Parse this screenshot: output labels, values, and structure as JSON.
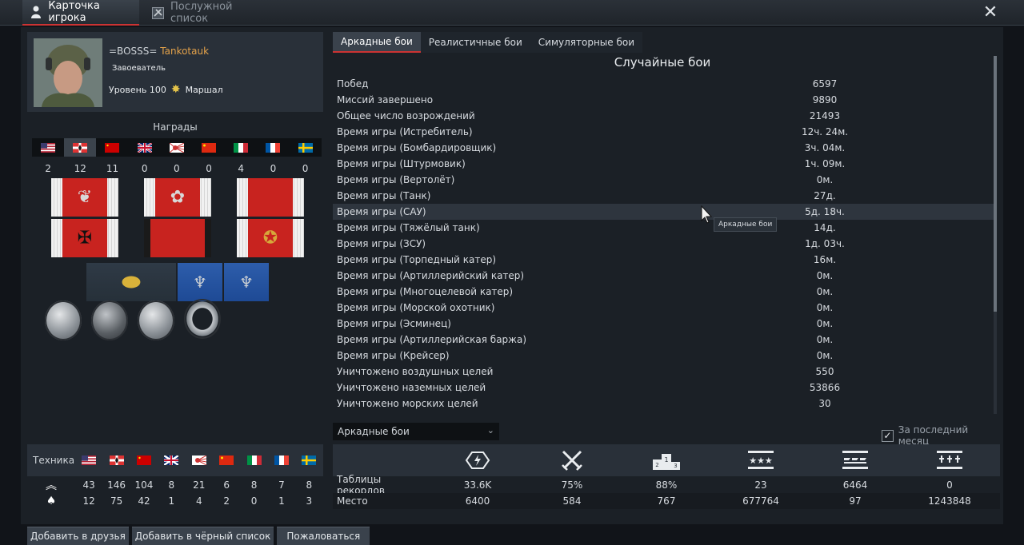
{
  "window": {
    "tabs": [
      {
        "label": "Карточка игрока",
        "active": true,
        "icon": "player-card-icon"
      },
      {
        "label": "Послужной список",
        "active": false,
        "icon": "service-record-icon"
      }
    ],
    "close_icon": "close-icon"
  },
  "profile": {
    "clan_tag": "=BOSSS=",
    "nickname": "Tankotauk",
    "title": "Завоеватель",
    "level_label": "Уровень 100",
    "rank": "Маршал"
  },
  "awards": {
    "title": "Награды",
    "nations": [
      "usa",
      "germany",
      "ussr",
      "britain",
      "japan",
      "china",
      "italy",
      "france",
      "sweden"
    ],
    "selected_nation_index": 1,
    "counts": [
      "2",
      "12",
      "11",
      "0",
      "0",
      "0",
      "4",
      "0",
      "0"
    ]
  },
  "tech": {
    "label": "Техника",
    "nations": [
      "usa",
      "germany",
      "ussr",
      "britain",
      "japan",
      "china",
      "italy",
      "france",
      "sweden"
    ],
    "row_top": [
      "43",
      "146",
      "104",
      "8",
      "21",
      "6",
      "8",
      "7",
      "8"
    ],
    "row_bottom": [
      "12",
      "75",
      "42",
      "1",
      "4",
      "2",
      "0",
      "1",
      "3"
    ]
  },
  "stats_tabs": [
    {
      "label": "Аркадные бои",
      "active": true
    },
    {
      "label": "Реалистичные бои",
      "active": false
    },
    {
      "label": "Симуляторные бои",
      "active": false
    }
  ],
  "stats": {
    "title": "Случайные бои",
    "rows": [
      {
        "name": "Побед",
        "value": "6597"
      },
      {
        "name": "Миссий завершено",
        "value": "9890"
      },
      {
        "name": "Общее число возрождений",
        "value": "21493"
      },
      {
        "name": "Время игры (Истребитель)",
        "value": "12ч. 24м."
      },
      {
        "name": "Время игры (Бомбардировщик)",
        "value": "3ч. 04м."
      },
      {
        "name": "Время игры (Штурмовик)",
        "value": "1ч. 09м."
      },
      {
        "name": "Время игры (Вертолёт)",
        "value": "0м."
      },
      {
        "name": "Время игры (Танк)",
        "value": "27д."
      },
      {
        "name": "Время игры (САУ)",
        "value": "5д. 18ч."
      },
      {
        "name": "Время игры (Тяжёлый танк)",
        "value": "14д."
      },
      {
        "name": "Время игры (ЗСУ)",
        "value": "1д. 03ч."
      },
      {
        "name": "Время игры (Торпедный катер)",
        "value": "16м."
      },
      {
        "name": "Время игры (Артиллерийский катер)",
        "value": "0м."
      },
      {
        "name": "Время игры (Многоцелевой катер)",
        "value": "0м."
      },
      {
        "name": "Время игры (Морской охотник)",
        "value": "0м."
      },
      {
        "name": "Время игры (Эсминец)",
        "value": "0м."
      },
      {
        "name": "Время игры (Артиллерийская баржа)",
        "value": "0м."
      },
      {
        "name": "Время игры (Крейсер)",
        "value": "0м."
      },
      {
        "name": "Уничтожено воздушных целей",
        "value": "550"
      },
      {
        "name": "Уничтожено наземных целей",
        "value": "53866"
      },
      {
        "name": "Уничтожено морских целей",
        "value": "30"
      }
    ],
    "highlighted_row": 8,
    "tooltip": "Аркадные бои"
  },
  "filter": {
    "dropdown_value": "Аркадные бои",
    "checkbox_label": "За последний месяц",
    "checkbox_checked": true
  },
  "records": {
    "icons": [
      "efficiency-icon",
      "crossed-swords-icon",
      "podium-icon",
      "stars-icon",
      "kills-icon",
      "ground-targets-icon"
    ],
    "row1_label": "Таблицы рекордов",
    "row1": [
      "33.6K",
      "75%",
      "88%",
      "23",
      "6464",
      "0"
    ],
    "row2_label": "Место",
    "row2": [
      "6400",
      "584",
      "767",
      "677764",
      "97",
      "1243848"
    ]
  },
  "buttons": {
    "add_friend": "Добавить в друзья",
    "add_blacklist": "Добавить в чёрный список",
    "complain": "Пожаловаться"
  }
}
